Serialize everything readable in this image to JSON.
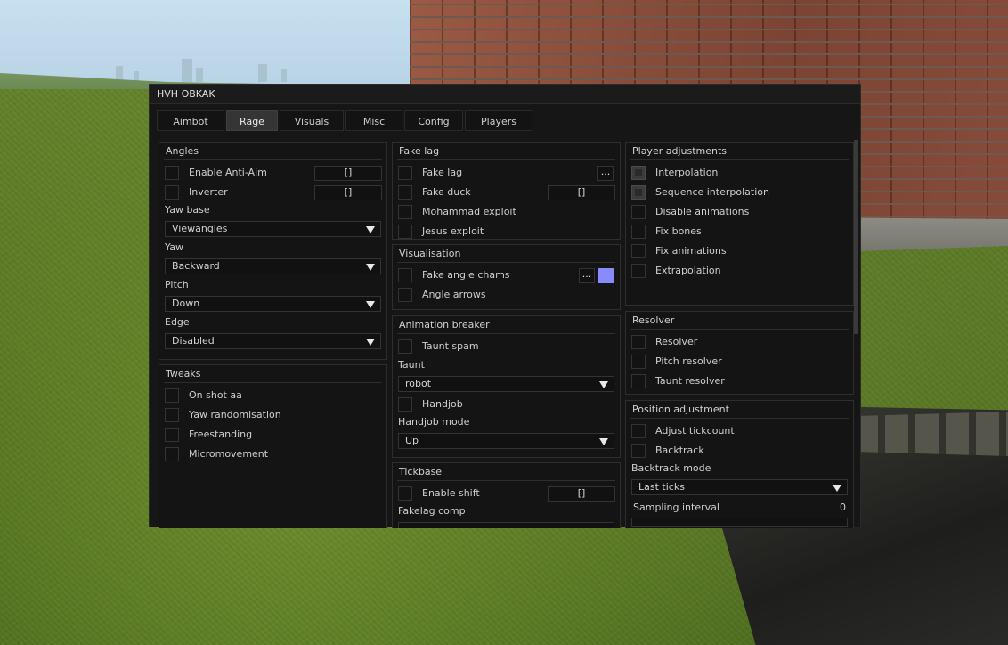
{
  "window": {
    "title": "HVH OBKAK"
  },
  "tabs": [
    {
      "label": "Aimbot"
    },
    {
      "label": "Rage"
    },
    {
      "label": "Visuals"
    },
    {
      "label": "Misc"
    },
    {
      "label": "Config"
    },
    {
      "label": "Players"
    }
  ],
  "active_tab": "Rage",
  "angles": {
    "title": "Angles",
    "enable_anti_aim": {
      "label": "Enable Anti-Aim",
      "checked": false,
      "key": "[]"
    },
    "inverter": {
      "label": "Inverter",
      "checked": false,
      "key": "[]"
    },
    "yaw_base": {
      "label": "Yaw base",
      "value": "Viewangles"
    },
    "yaw": {
      "label": "Yaw",
      "value": "Backward"
    },
    "pitch": {
      "label": "Pitch",
      "value": "Down"
    },
    "edge": {
      "label": "Edge",
      "value": "Disabled"
    }
  },
  "tweaks": {
    "title": "Tweaks",
    "items": [
      {
        "label": "On shot aa",
        "checked": false
      },
      {
        "label": "Yaw randomisation",
        "checked": false
      },
      {
        "label": "Freestanding",
        "checked": false
      },
      {
        "label": "Micromovement",
        "checked": false
      }
    ]
  },
  "fake_lag": {
    "title": "Fake lag",
    "fake_lag": {
      "label": "Fake lag",
      "checked": false,
      "more": "..."
    },
    "fake_duck": {
      "label": "Fake duck",
      "checked": false,
      "key": "[]"
    },
    "mohammad_exploit": {
      "label": "Mohammad exploit",
      "checked": false
    },
    "jesus_exploit": {
      "label": "Jesus exploit",
      "checked": false
    }
  },
  "visualisation": {
    "title": "Visualisation",
    "fake_angle_chams": {
      "label": "Fake angle chams",
      "checked": false,
      "more": "...",
      "color": "#8a8aff"
    },
    "angle_arrows": {
      "label": "Angle arrows",
      "checked": false
    }
  },
  "animation_breaker": {
    "title": "Animation breaker",
    "taunt_spam": {
      "label": "Taunt spam",
      "checked": false
    },
    "taunt": {
      "label": "Taunt",
      "value": "robot"
    },
    "handjob": {
      "label": "Handjob",
      "checked": false
    },
    "handjob_mode": {
      "label": "Handjob mode",
      "value": "Up"
    }
  },
  "tickbase": {
    "title": "Tickbase",
    "enable_shift": {
      "label": "Enable shift",
      "checked": false,
      "key": "[]"
    },
    "fakelag_comp": {
      "label": "Fakelag comp"
    }
  },
  "player_adjustments": {
    "title": "Player adjustments",
    "items": [
      {
        "label": "Interpolation",
        "checked": true
      },
      {
        "label": "Sequence interpolation",
        "checked": true
      },
      {
        "label": "Disable animations",
        "checked": false
      },
      {
        "label": "Fix bones",
        "checked": false
      },
      {
        "label": "Fix animations",
        "checked": false
      },
      {
        "label": "Extrapolation",
        "checked": false
      }
    ]
  },
  "resolver": {
    "title": "Resolver",
    "items": [
      {
        "label": "Resolver",
        "checked": false
      },
      {
        "label": "Pitch resolver",
        "checked": false
      },
      {
        "label": "Taunt resolver",
        "checked": false
      }
    ]
  },
  "position_adjustment": {
    "title": "Position adjustment",
    "adjust_tickcount": {
      "label": "Adjust tickcount",
      "checked": false
    },
    "backtrack": {
      "label": "Backtrack",
      "checked": false
    },
    "backtrack_mode": {
      "label": "Backtrack mode",
      "value": "Last ticks"
    },
    "sampling_interval": {
      "label": "Sampling interval",
      "value": "0"
    }
  }
}
